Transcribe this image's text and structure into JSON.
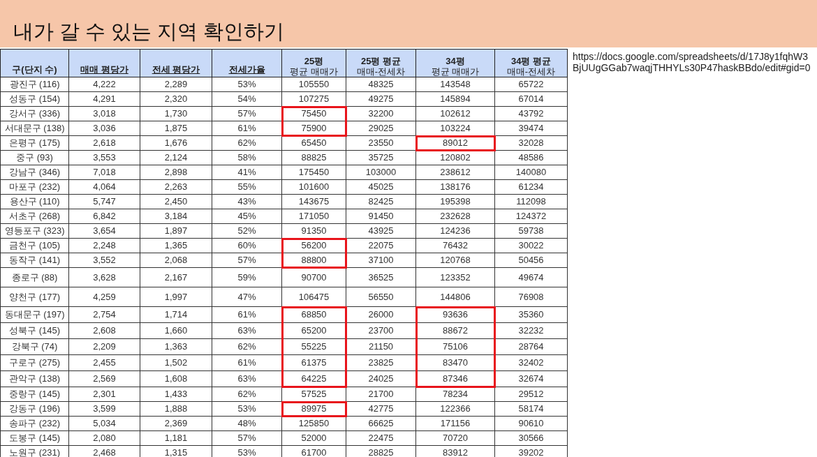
{
  "title": "내가 갈 수 있는 지역 확인하기",
  "table": {
    "columns": [
      {
        "lines": [
          "구(단지 수)"
        ],
        "underlined": false
      },
      {
        "lines": [
          "매매 평당가"
        ],
        "underlined": true
      },
      {
        "lines": [
          "전세 평당가"
        ],
        "underlined": true
      },
      {
        "lines": [
          "전세가율"
        ],
        "underlined": true
      },
      {
        "lines": [
          "25평",
          "평균 매매가"
        ],
        "underlined": false
      },
      {
        "lines": [
          "25평 평균",
          "매매-전세차"
        ],
        "underlined": false
      },
      {
        "lines": [
          "34평",
          "평균 매매가"
        ],
        "underlined": false
      },
      {
        "lines": [
          "34평 평균",
          "매매-전세차"
        ],
        "underlined": false
      }
    ],
    "rows": [
      {
        "cells": [
          "광진구 (116)",
          "4,222",
          "2,289",
          "53%",
          "105550",
          "48325",
          "143548",
          "65722"
        ],
        "p25_boxed": false,
        "p34_boxed": false
      },
      {
        "cells": [
          "성동구 (154)",
          "4,291",
          "2,320",
          "54%",
          "107275",
          "49275",
          "145894",
          "67014"
        ],
        "p25_boxed": false,
        "p34_boxed": false
      },
      {
        "cells": [
          "강서구 (336)",
          "3,018",
          "1,730",
          "57%",
          "75450",
          "32200",
          "102612",
          "43792"
        ],
        "p25_boxed": true,
        "p34_boxed": false
      },
      {
        "cells": [
          "서대문구 (138)",
          "3,036",
          "1,875",
          "61%",
          "75900",
          "29025",
          "103224",
          "39474"
        ],
        "p25_boxed": true,
        "p34_boxed": false
      },
      {
        "cells": [
          "은평구 (175)",
          "2,618",
          "1,676",
          "62%",
          "65450",
          "23550",
          "89012",
          "32028"
        ],
        "p25_boxed": false,
        "p34_boxed": true
      },
      {
        "cells": [
          "중구 (93)",
          "3,553",
          "2,124",
          "58%",
          "88825",
          "35725",
          "120802",
          "48586"
        ],
        "p25_boxed": false,
        "p34_boxed": false
      },
      {
        "cells": [
          "강남구 (346)",
          "7,018",
          "2,898",
          "41%",
          "175450",
          "103000",
          "238612",
          "140080"
        ],
        "p25_boxed": false,
        "p34_boxed": false
      },
      {
        "cells": [
          "마포구 (232)",
          "4,064",
          "2,263",
          "55%",
          "101600",
          "45025",
          "138176",
          "61234"
        ],
        "p25_boxed": false,
        "p34_boxed": false
      },
      {
        "cells": [
          "용산구 (110)",
          "5,747",
          "2,450",
          "43%",
          "143675",
          "82425",
          "195398",
          "112098"
        ],
        "p25_boxed": false,
        "p34_boxed": false
      },
      {
        "cells": [
          "서초구 (268)",
          "6,842",
          "3,184",
          "45%",
          "171050",
          "91450",
          "232628",
          "124372"
        ],
        "p25_boxed": false,
        "p34_boxed": false
      },
      {
        "cells": [
          "영등포구 (323)",
          "3,654",
          "1,897",
          "52%",
          "91350",
          "43925",
          "124236",
          "59738"
        ],
        "p25_boxed": false,
        "p34_boxed": false
      },
      {
        "cells": [
          "금천구 (105)",
          "2,248",
          "1,365",
          "60%",
          "56200",
          "22075",
          "76432",
          "30022"
        ],
        "p25_boxed": true,
        "p34_boxed": false
      },
      {
        "cells": [
          "동작구 (141)",
          "3,552",
          "2,068",
          "57%",
          "88800",
          "37100",
          "120768",
          "50456"
        ],
        "p25_boxed": true,
        "p34_boxed": false
      },
      {
        "cells": [
          "종로구 (88)",
          "3,628",
          "2,167",
          "59%",
          "90700",
          "36525",
          "123352",
          "49674"
        ],
        "p25_boxed": false,
        "p34_boxed": false
      },
      {
        "cells": [
          "양천구 (177)",
          "4,259",
          "1,997",
          "47%",
          "106475",
          "56550",
          "144806",
          "76908"
        ],
        "p25_boxed": false,
        "p34_boxed": false
      },
      {
        "cells": [
          "동대문구 (197)",
          "2,754",
          "1,714",
          "61%",
          "68850",
          "26000",
          "93636",
          "35360"
        ],
        "p25_boxed": true,
        "p34_boxed": true
      },
      {
        "cells": [
          "성북구 (145)",
          "2,608",
          "1,660",
          "63%",
          "65200",
          "23700",
          "88672",
          "32232"
        ],
        "p25_boxed": true,
        "p34_boxed": true
      },
      {
        "cells": [
          "강북구 (74)",
          "2,209",
          "1,363",
          "62%",
          "55225",
          "21150",
          "75106",
          "28764"
        ],
        "p25_boxed": true,
        "p34_boxed": true
      },
      {
        "cells": [
          "구로구 (275)",
          "2,455",
          "1,502",
          "61%",
          "61375",
          "23825",
          "83470",
          "32402"
        ],
        "p25_boxed": true,
        "p34_boxed": true
      },
      {
        "cells": [
          "관악구 (138)",
          "2,569",
          "1,608",
          "63%",
          "64225",
          "24025",
          "87346",
          "32674"
        ],
        "p25_boxed": true,
        "p34_boxed": true
      },
      {
        "cells": [
          "중랑구 (145)",
          "2,301",
          "1,433",
          "62%",
          "57525",
          "21700",
          "78234",
          "29512"
        ],
        "p25_boxed": false,
        "p34_boxed": false
      },
      {
        "cells": [
          "강동구 (196)",
          "3,599",
          "1,888",
          "53%",
          "89975",
          "42775",
          "122366",
          "58174"
        ],
        "p25_boxed": true,
        "p34_boxed": false
      },
      {
        "cells": [
          "송파구 (232)",
          "5,034",
          "2,369",
          "48%",
          "125850",
          "66625",
          "171156",
          "90610"
        ],
        "p25_boxed": false,
        "p34_boxed": false
      },
      {
        "cells": [
          "도봉구 (145)",
          "2,080",
          "1,181",
          "57%",
          "52000",
          "22475",
          "70720",
          "30566"
        ],
        "p25_boxed": false,
        "p34_boxed": false
      },
      {
        "cells": [
          "노원구 (231)",
          "2,468",
          "1,315",
          "53%",
          "61700",
          "28825",
          "83912",
          "39202"
        ],
        "p25_boxed": false,
        "p34_boxed": false
      }
    ]
  },
  "source_url": "https://docs.google.com/spreadsheets/d/17J8y1fqhW3BjUUgGGab7waqjTHHYLs30P47haskBBdo/edit#gid=0"
}
